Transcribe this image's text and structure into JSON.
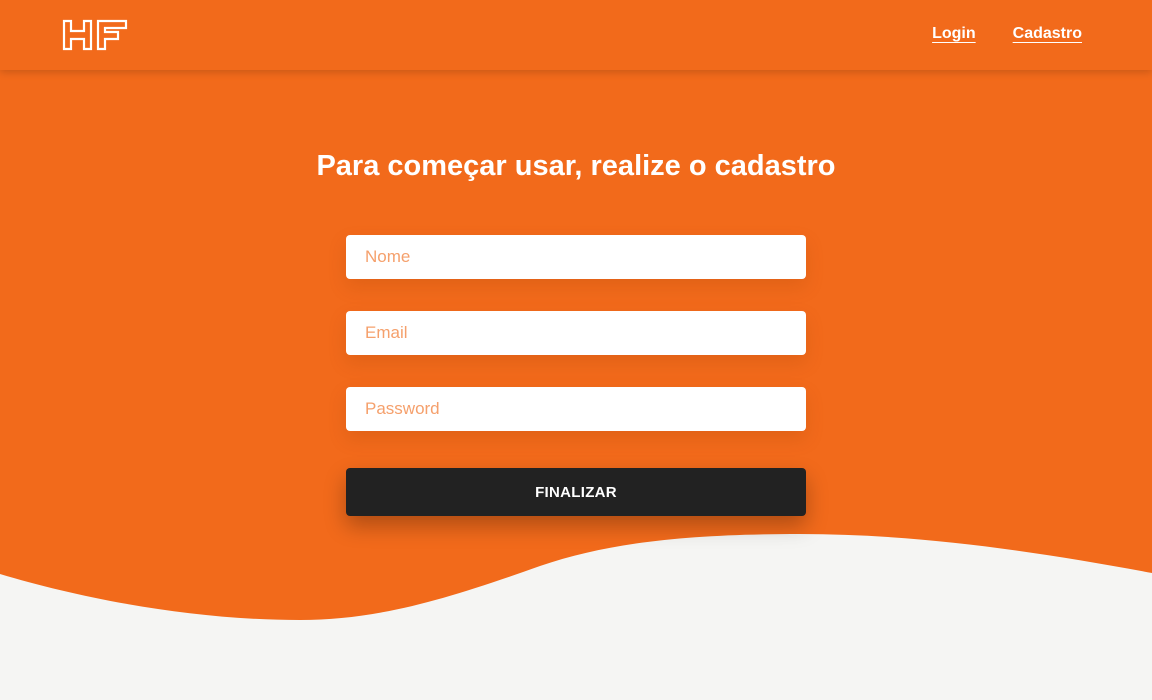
{
  "brand": {
    "logo_text": "HF",
    "primary_color": "#f26a1b",
    "background_color": "#f5f5f3",
    "button_color": "#222222"
  },
  "nav": {
    "login": "Login",
    "signup": "Cadastro"
  },
  "form": {
    "title": "Para começar usar, realize o cadastro",
    "name_placeholder": "Nome",
    "email_placeholder": "Email",
    "password_placeholder": "Password",
    "submit_label": "FINALIZAR"
  }
}
